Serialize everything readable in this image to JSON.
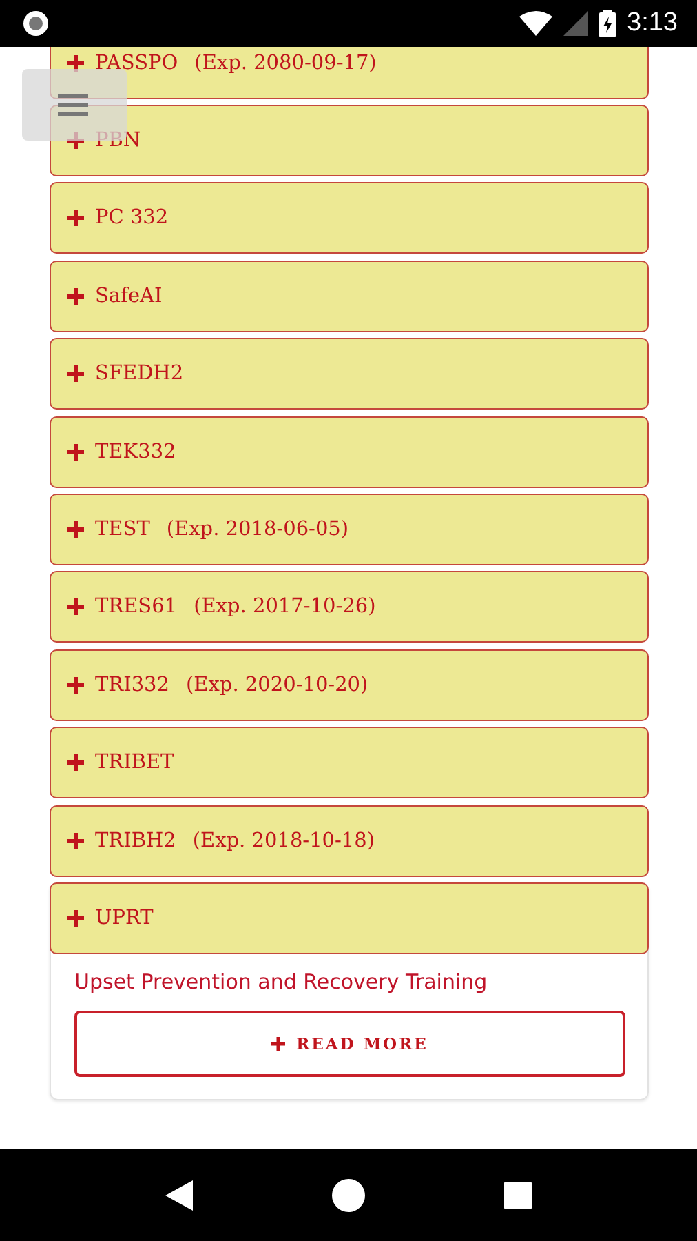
{
  "status_bar": {
    "time": "3:13"
  },
  "courses": [
    {
      "name": "PASSPO",
      "expiry": "(Exp. 2080-09-17)",
      "expanded": false
    },
    {
      "name": "PBN",
      "expanded": false
    },
    {
      "name": "PC 332",
      "expanded": false
    },
    {
      "name": "SafeAI",
      "expanded": false
    },
    {
      "name": "SFEDH2",
      "expanded": false
    },
    {
      "name": "TEK332",
      "expanded": false
    },
    {
      "name": "TEST",
      "expiry": "(Exp. 2018-06-05)",
      "expanded": false
    },
    {
      "name": "TRES61",
      "expiry": "(Exp. 2017-10-26)",
      "expanded": false
    },
    {
      "name": "TRI332",
      "expiry": "(Exp. 2020-10-20)",
      "expanded": false
    },
    {
      "name": "TRIBET",
      "expanded": false
    },
    {
      "name": "TRIBH2",
      "expiry": "(Exp. 2018-10-18)",
      "expanded": false
    },
    {
      "name": "UPRT",
      "expanded": true,
      "description": "Upset Prevention and Recovery Training",
      "button": "READ MORE"
    }
  ]
}
